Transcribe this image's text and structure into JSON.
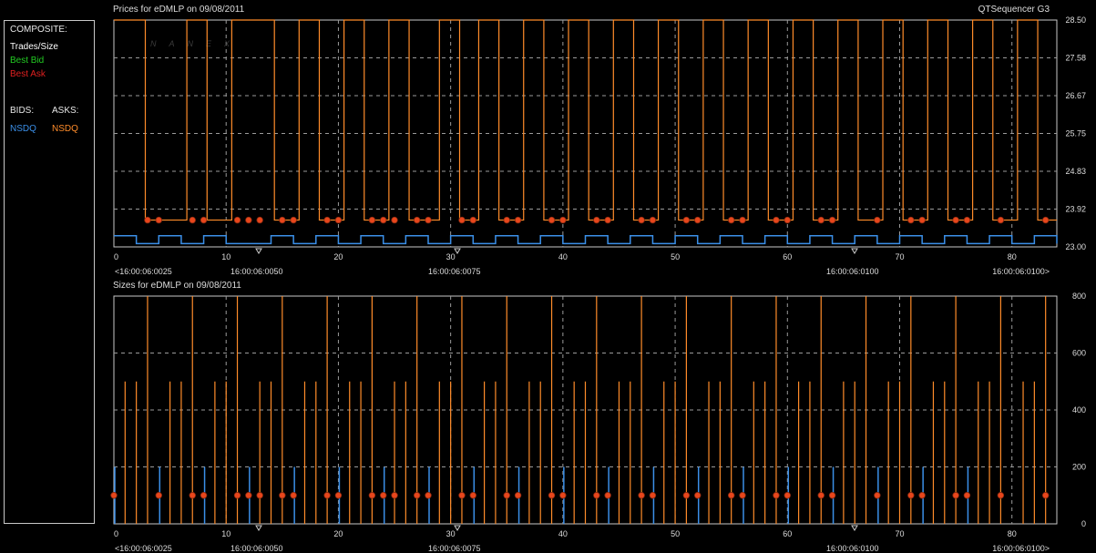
{
  "app_name": "QTSequencer G3",
  "watermark": "NANEX",
  "legend": {
    "composite_label": "COMPOSITE:",
    "trades_label": "Trades/Size",
    "best_bid_label": "Best Bid",
    "best_ask_label": "Best Ask",
    "bids_label": "BIDS:",
    "asks_label": "ASKS:",
    "bid_exchange": "NSDQ",
    "ask_exchange": "NSDQ"
  },
  "colors": {
    "ask": "#ff8c2a",
    "bid": "#3b8fe8",
    "trade_marker": "#e8461c",
    "best_bid": "#22cc22",
    "best_ask": "#e02020",
    "grid": "#9a9a9a",
    "frame": "#c8c8c8"
  },
  "chart_data": [
    {
      "type": "line",
      "title": "Prices for  eDMLP  on  09/08/2011",
      "x_ticks": [
        "0",
        "10",
        "20",
        "30",
        "40",
        "50",
        "60",
        "70",
        "80"
      ],
      "x_range": [
        0,
        84
      ],
      "time_labels": [
        "<16:00:06:0025",
        "16:00:06:0050",
        "16:00:06:0075",
        "16:00:06:0100",
        "16:00:06:0100>"
      ],
      "y_ticks": [
        "28.50",
        "27.58",
        "26.67",
        "25.75",
        "24.83",
        "23.92",
        "23.00"
      ],
      "ylim": [
        23.0,
        28.5
      ],
      "grid": true,
      "ask_low": 23.65,
      "ask_high": 28.5,
      "ask_high_intervals": [
        [
          0,
          2.8
        ],
        [
          6.5,
          8.3
        ],
        [
          10.5,
          14.3
        ],
        [
          16.5,
          18.3
        ],
        [
          20.5,
          22.3
        ],
        [
          24.5,
          26.3
        ],
        [
          29.0,
          30.8
        ],
        [
          32.5,
          34.3
        ],
        [
          36.5,
          38.3
        ],
        [
          40.5,
          42.3
        ],
        [
          44.5,
          46.3
        ],
        [
          48.5,
          50.3
        ],
        [
          52.5,
          54.3
        ],
        [
          56.5,
          58.3
        ],
        [
          60.5,
          62.3
        ],
        [
          64.5,
          66.3
        ],
        [
          68.5,
          70.3
        ],
        [
          72.5,
          74.3
        ],
        [
          76.5,
          78.3
        ],
        [
          80.5,
          82.3
        ]
      ],
      "bid_low": 23.08,
      "bid_high": 23.27,
      "bid_high_intervals": [
        [
          0,
          2.0
        ],
        [
          4.0,
          6.0
        ],
        [
          8.0,
          10.0
        ],
        [
          14.0,
          16.0
        ],
        [
          18.0,
          20.0
        ],
        [
          22.0,
          24.0
        ],
        [
          26.0,
          28.0
        ],
        [
          30.0,
          32.0
        ],
        [
          34.0,
          36.0
        ],
        [
          38.0,
          40.0
        ],
        [
          42.0,
          44.0
        ],
        [
          46.0,
          48.0
        ],
        [
          50.0,
          52.0
        ],
        [
          54.0,
          56.0
        ],
        [
          58.0,
          60.0
        ],
        [
          62.0,
          64.0
        ],
        [
          66.0,
          68.0
        ],
        [
          70.0,
          72.0
        ],
        [
          74.0,
          76.0
        ],
        [
          78.0,
          80.0
        ],
        [
          82.0,
          84.0
        ]
      ],
      "trade_price": 23.65,
      "trade_x": [
        3,
        4,
        7,
        8,
        11,
        12,
        13,
        15,
        16,
        19,
        20,
        23,
        24,
        25,
        27,
        28,
        31,
        32,
        35,
        36,
        39,
        40,
        43,
        44,
        47,
        48,
        51,
        52,
        55,
        56,
        59,
        60,
        63,
        64,
        68,
        71,
        72,
        75,
        76,
        79,
        83
      ]
    },
    {
      "type": "bar",
      "title": "Sizes for  eDMLP  on  09/08/2011",
      "x_ticks": [
        "0",
        "10",
        "20",
        "30",
        "40",
        "50",
        "60",
        "70",
        "80"
      ],
      "x_range": [
        0,
        84
      ],
      "time_labels": [
        "<16:00:06:0025",
        "16:00:06:0050",
        "16:00:06:0075",
        "16:00:06:0100",
        "16:00:06:0100>"
      ],
      "y_ticks": [
        "800",
        "600",
        "400",
        "200",
        "0"
      ],
      "ylim": [
        0,
        800
      ],
      "grid": true,
      "ask_sizes": {
        "value": 500,
        "x": [
          1,
          2,
          5,
          6,
          9,
          10,
          13,
          14,
          17,
          18,
          21,
          22,
          25,
          26,
          29,
          30,
          33,
          34,
          37,
          38,
          41,
          42,
          45,
          46,
          49,
          50,
          53,
          54,
          57,
          58,
          61,
          62,
          65,
          66,
          69,
          70,
          73,
          74,
          77,
          78,
          81,
          82
        ]
      },
      "ask_sizes_full": {
        "value": 800,
        "x": [
          3,
          7,
          11,
          15,
          19,
          23,
          27,
          31,
          35,
          39,
          43,
          47,
          51,
          55,
          59,
          63,
          67,
          71,
          75,
          79,
          83
        ]
      },
      "bid_sizes": {
        "value": 200,
        "x": [
          0,
          4,
          8,
          12,
          16,
          20,
          24,
          28,
          32,
          36,
          40,
          44,
          48,
          52,
          56,
          60,
          64,
          68,
          72,
          76
        ]
      },
      "trade_size": 100,
      "trade_x": [
        0,
        4,
        7,
        8,
        11,
        12,
        13,
        15,
        16,
        19,
        20,
        23,
        24,
        25,
        27,
        28,
        31,
        32,
        35,
        36,
        39,
        40,
        43,
        44,
        47,
        48,
        51,
        52,
        55,
        56,
        59,
        60,
        63,
        64,
        68,
        71,
        72,
        75,
        76,
        79,
        83
      ]
    }
  ]
}
